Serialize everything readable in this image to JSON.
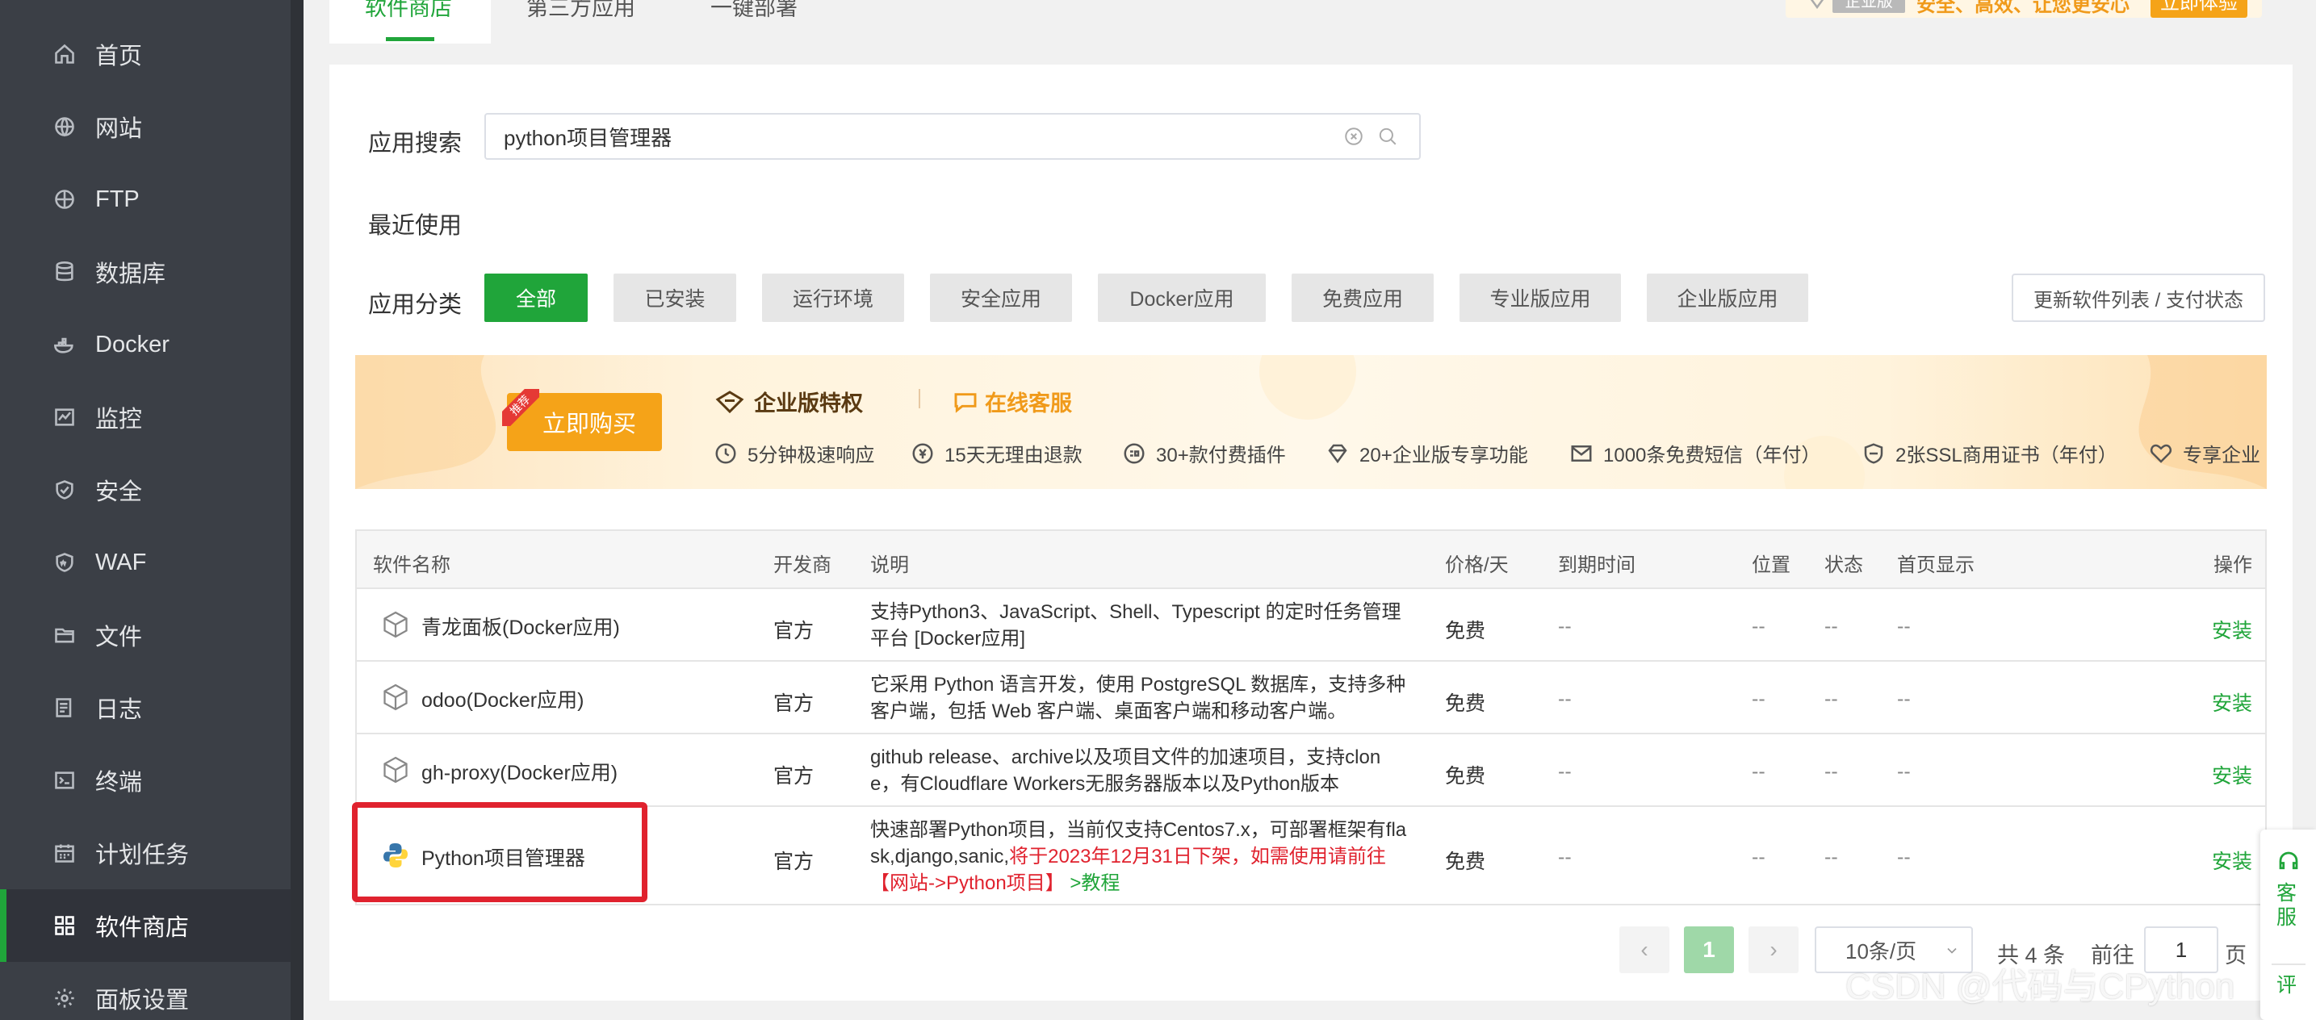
{
  "sidebar": {
    "items": [
      {
        "label": "首页",
        "icon": "home-icon"
      },
      {
        "label": "网站",
        "icon": "globe-icon"
      },
      {
        "label": "FTP",
        "icon": "ftp-globe-icon"
      },
      {
        "label": "数据库",
        "icon": "database-icon"
      },
      {
        "label": "Docker",
        "icon": "docker-icon"
      },
      {
        "label": "监控",
        "icon": "monitor-icon"
      },
      {
        "label": "安全",
        "icon": "shield-icon"
      },
      {
        "label": "WAF",
        "icon": "waf-shield-icon"
      },
      {
        "label": "文件",
        "icon": "folder-icon"
      },
      {
        "label": "日志",
        "icon": "log-icon"
      },
      {
        "label": "终端",
        "icon": "terminal-icon"
      },
      {
        "label": "计划任务",
        "icon": "calendar-icon"
      },
      {
        "label": "软件商店",
        "icon": "grid-icon"
      },
      {
        "label": "面板设置",
        "icon": "gear-icon"
      }
    ],
    "active_index": 12
  },
  "top_tabs": [
    {
      "label": "软件商店"
    },
    {
      "label": "第三方应用"
    },
    {
      "label": "一键部署"
    }
  ],
  "top_right": {
    "badge": "企业版",
    "slogan": "安全、高效、让您更安心",
    "trial_button": "立即体验"
  },
  "search": {
    "label": "应用搜索",
    "value": "python项目管理器"
  },
  "recent": {
    "label": "最近使用"
  },
  "categories": {
    "label": "应用分类",
    "items": [
      "全部",
      "已安装",
      "运行环境",
      "安全应用",
      "Docker应用",
      "免费应用",
      "专业版应用",
      "企业版应用"
    ],
    "active": "全部",
    "refresh_button": "更新软件列表 / 支付状态"
  },
  "banner": {
    "ribbon": "推荐",
    "buy_button": "立即购买",
    "title": "企业版特权",
    "service_link": "在线客服",
    "features": [
      {
        "text": "5分钟极速响应",
        "icon": "clock-icon"
      },
      {
        "text": "15天无理由退款",
        "icon": "refund-icon"
      },
      {
        "text": "30+款付费插件",
        "icon": "plugin-icon"
      },
      {
        "text": "20+企业版专享功能",
        "icon": "diamond-icon"
      },
      {
        "text": "1000条免费短信（年付）",
        "icon": "mail-icon"
      },
      {
        "text": "2张SSL商用证书（年付）",
        "icon": "ssl-icon"
      },
      {
        "text": "专享企业",
        "icon": "heart-icon"
      }
    ]
  },
  "table": {
    "headers": [
      "软件名称",
      "开发商",
      "说明",
      "价格/天",
      "到期时间",
      "位置",
      "状态",
      "首页显示",
      "操作"
    ],
    "rows": [
      {
        "name": "青龙面板(Docker应用)",
        "icon": "package-icon",
        "developer": "官方",
        "desc_line1": "支持Python3、JavaScript、Shell、Typescript 的定时任务管理",
        "desc_line2": "平台 [Docker应用]",
        "price": "免费",
        "expire": "--",
        "location": "--",
        "status": "--",
        "homepage": "--",
        "action": "安装"
      },
      {
        "name": "odoo(Docker应用)",
        "icon": "package-icon",
        "developer": "官方",
        "desc_line1": "它采用 Python 语言开发，使用 PostgreSQL 数据库，支持多种",
        "desc_line2": "客户端，包括 Web 客户端、桌面客户端和移动客户端。",
        "price": "免费",
        "expire": "--",
        "location": "--",
        "status": "--",
        "homepage": "--",
        "action": "安装"
      },
      {
        "name": "gh-proxy(Docker应用)",
        "icon": "package-icon",
        "developer": "官方",
        "desc_line1": "github release、archive以及项目文件的加速项目，支持clon",
        "desc_line2": "e，有Cloudflare Workers无服务器版本以及Python版本",
        "price": "免费",
        "expire": "--",
        "location": "--",
        "status": "--",
        "homepage": "--",
        "action": "安装"
      },
      {
        "name": "Python项目管理器",
        "icon": "python-icon",
        "developer": "官方",
        "desc_line1": "快速部署Python项目，当前仅支持Centos7.x，可部署框架有fla",
        "desc_line2_normal": "sk,django,sanic,",
        "desc_line2_warn": "将于2023年12月31日下架，如需使用请前往",
        "desc_line3_warn": "【网站->Python项目】",
        "desc_line3_link": " >教程",
        "price": "免费",
        "expire": "--",
        "location": "--",
        "status": "--",
        "homepage": "--",
        "action": "安装"
      }
    ]
  },
  "pagination": {
    "prev": "‹",
    "current": "1",
    "next": "›",
    "page_size": "10条/页",
    "total": "共 4 条",
    "goto_label": "前往",
    "goto_value": "1",
    "page_unit": "页"
  },
  "float_service": {
    "label_1": "客服",
    "label_2": "评"
  },
  "watermark": "CSDN @代码与CPython",
  "colors": {
    "accent": "#20a53a",
    "warning": "#e0222e",
    "banner_orange": "#f5a318",
    "sidebar_bg": "#3b3f46"
  }
}
